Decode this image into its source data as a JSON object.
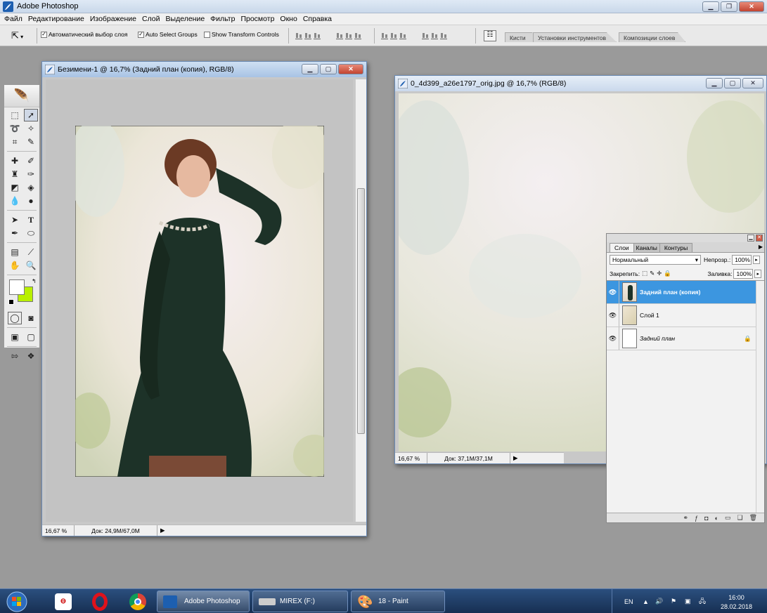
{
  "app": {
    "title": "Adobe Photoshop"
  },
  "menu": [
    "Файл",
    "Редактирование",
    "Изображение",
    "Слой",
    "Выделение",
    "Фильтр",
    "Просмотр",
    "Окно",
    "Справка"
  ],
  "options": {
    "auto_select_layer": "Автоматический выбор слоя",
    "auto_select_groups": "Auto Select Groups",
    "show_transform": "Show Transform Controls",
    "auto_select_layer_checked": true,
    "auto_select_groups_checked": true,
    "show_transform_checked": false
  },
  "panel_well_tabs": [
    "Кисти",
    "Установки инструментов",
    "Композиции слоев"
  ],
  "colors": {
    "foreground": "#ffffff",
    "background": "#b9f000",
    "selection": "#3c96e0"
  },
  "doc1": {
    "title": "Безимени-1 @ 16,7% (Задний план (копия), RGB/8)",
    "zoom": "16,67 %",
    "doc_size": "Док: 24,9M/67,0M"
  },
  "doc2": {
    "title": "0_4d399_a26e1797_orig.jpg @ 16,7% (RGB/8)",
    "zoom": "16,67 %",
    "doc_size": "Док: 37,1M/37,1M"
  },
  "layers_panel": {
    "tabs": [
      "Слои",
      "Каналы",
      "Контуры"
    ],
    "blend_mode": "Нормальный",
    "opacity_label": "Непрозр.:",
    "opacity_value": "100%",
    "lock_label": "Закрепить:",
    "fill_label": "Заливка:",
    "fill_value": "100%",
    "layers": [
      {
        "name": "Задний план (копия)",
        "active": true
      },
      {
        "name": "Слой 1",
        "active": false
      },
      {
        "name": "Задний план",
        "active": false,
        "locked": true
      }
    ]
  },
  "taskbar": {
    "tasks": [
      "Adobe Photoshop",
      "MIREX (F:)",
      "18 - Paint"
    ],
    "lang": "EN",
    "time": "16:00",
    "date": "28.02.2018"
  }
}
